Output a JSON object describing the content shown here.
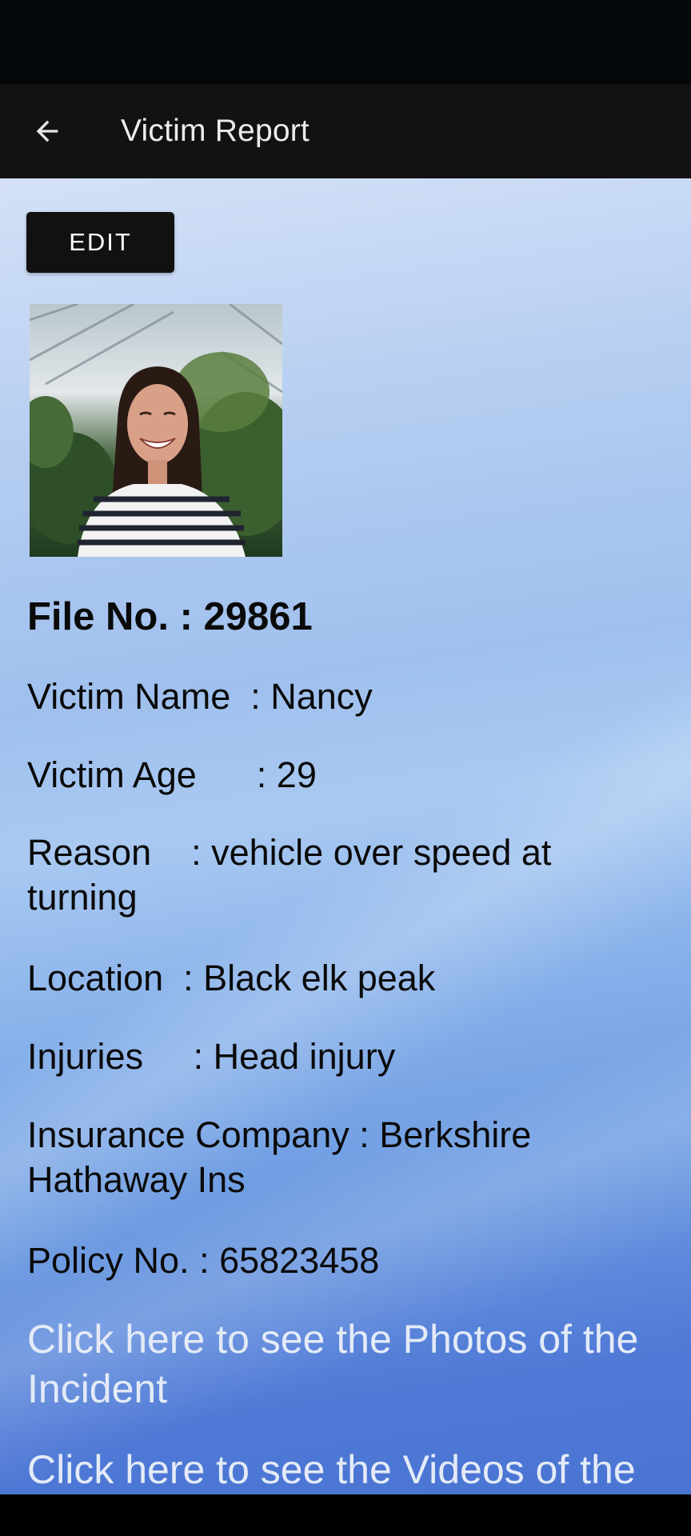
{
  "app_bar": {
    "title": "Victim Report",
    "back_icon": "arrow-left-icon"
  },
  "actions": {
    "edit_label": "EDIT"
  },
  "report": {
    "file_no": "File No. : 29861",
    "victim_name": "Victim Name  : Nancy",
    "victim_age": "Victim Age      : 29",
    "reason": "Reason    : vehicle over speed at turning",
    "location": "Location  : Black elk peak",
    "injuries": "Injuries     : Head injury",
    "insurance": "Insurance Company : Berkshire Hathaway Ins",
    "policy_no": "Policy No. : 65823458"
  },
  "links": {
    "photos": "Click here to see the Photos of the Incident",
    "videos": "Click here to see the Videos of the"
  },
  "colors": {
    "app_bar": "#121212",
    "edit_button": "#111111",
    "link_text": "#e4ebf7",
    "body_text": "#0a0a0a"
  }
}
